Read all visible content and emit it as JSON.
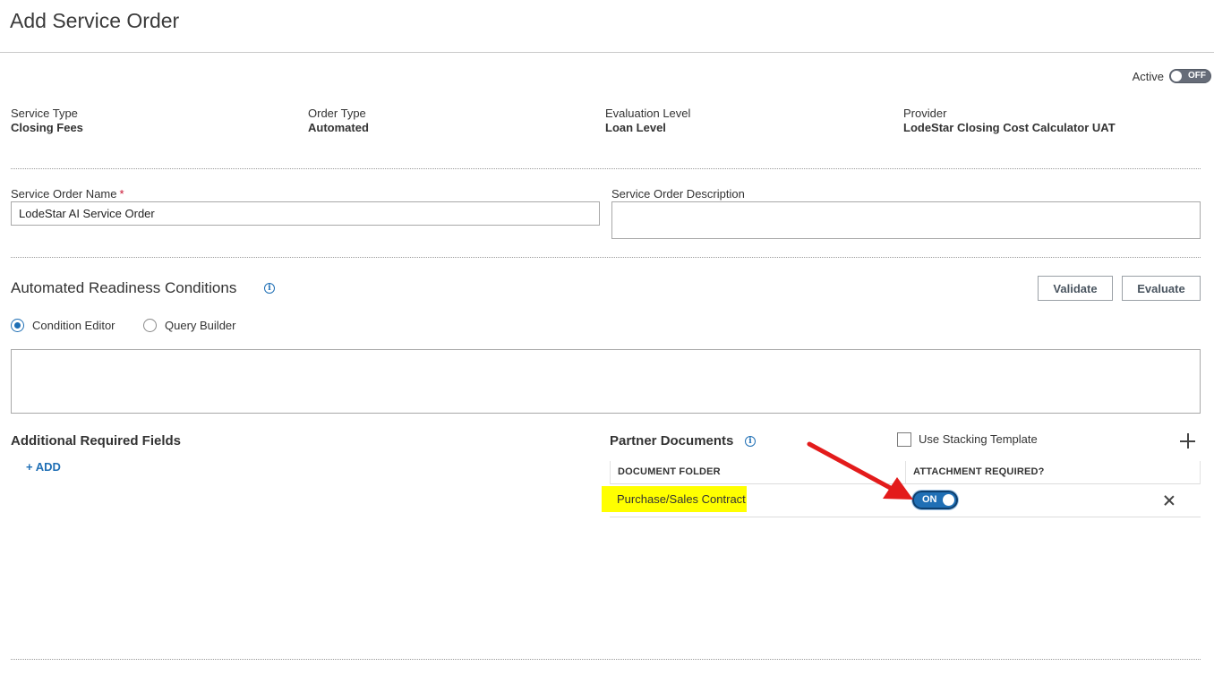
{
  "header": {
    "title": "Add Service Order"
  },
  "status": {
    "label": "Active",
    "toggle_text": "OFF"
  },
  "meta": [
    {
      "label": "Service Type",
      "value": "Closing Fees"
    },
    {
      "label": "Order Type",
      "value": "Automated"
    },
    {
      "label": "Evaluation Level",
      "value": "Loan Level"
    },
    {
      "label": "Provider",
      "value": "LodeStar Closing Cost Calculator UAT"
    }
  ],
  "form": {
    "name_label": "Service Order Name",
    "required_mark": "*",
    "name_value": "LodeStar AI Service Order",
    "description_label": "Service Order Description",
    "description_value": ""
  },
  "readiness": {
    "title": "Automated Readiness Conditions",
    "info_glyph": "i",
    "validate_label": "Validate",
    "evaluate_label": "Evaluate",
    "options": [
      "Condition Editor",
      "Query Builder"
    ],
    "selected_option": "Condition Editor"
  },
  "additional": {
    "title": "Additional Required Fields",
    "add_label": "+ ADD"
  },
  "partner": {
    "title": "Partner Documents",
    "info_glyph": "i",
    "stacking_label": "Use Stacking Template",
    "stacking_checked": false,
    "columns": [
      "DOCUMENT FOLDER",
      "ATTACHMENT REQUIRED?"
    ],
    "rows": [
      {
        "folder": "Purchase/Sales Contract",
        "attachment_required": "ON"
      }
    ]
  },
  "colors": {
    "accent": "#1f6fb5",
    "highlight": "#ffff00",
    "annotation_arrow": "#e31b1b",
    "required": "#c8102e"
  }
}
